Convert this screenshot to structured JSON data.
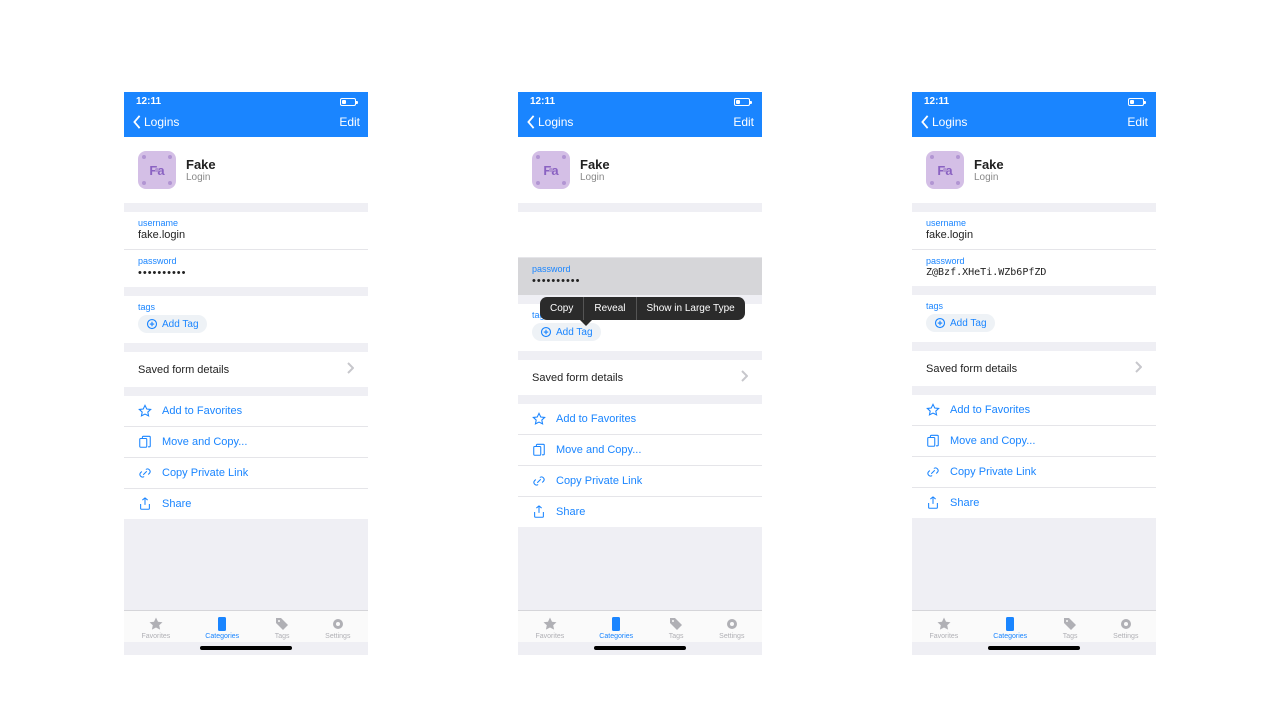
{
  "status": {
    "time": "12:11"
  },
  "nav": {
    "back": "Logins",
    "edit": "Edit"
  },
  "hero": {
    "initials": "Fa",
    "title": "Fake",
    "subtitle": "Login"
  },
  "fields": {
    "username_label": "username",
    "username_value": "fake.login",
    "password_label": "password",
    "password_masked": "••••••••••",
    "password_revealed": "Z@Bzf.XHeTi.WZb6PfZD",
    "tags_label": "tags",
    "add_tag": "Add Tag"
  },
  "popover": {
    "copy": "Copy",
    "reveal": "Reveal",
    "large": "Show in Large Type"
  },
  "rows": {
    "saved_form": "Saved form details"
  },
  "actions": {
    "favorites": "Add to Favorites",
    "move_copy": "Move and Copy...",
    "private_link": "Copy Private Link",
    "share": "Share"
  },
  "tabs": {
    "favorites": "Favorites",
    "categories": "Categories",
    "tags": "Tags",
    "settings": "Settings"
  }
}
